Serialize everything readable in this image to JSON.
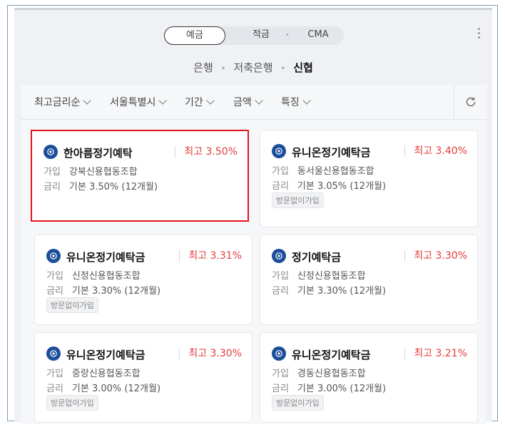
{
  "segments": {
    "items": [
      "예금",
      "적금",
      "CMA"
    ],
    "active": "예금"
  },
  "subtabs": {
    "items": [
      "은행",
      "저축은행",
      "신협"
    ],
    "active": "신협"
  },
  "filters": [
    "최고금리순",
    "서울특별시",
    "기간",
    "금액",
    "특징"
  ],
  "icons": {
    "refresh": "refresh-icon",
    "more": "more-vertical-icon",
    "bank_logo": "shinhyup-logo-icon",
    "chevron": "chevron-down-icon"
  },
  "colors": {
    "rate_red": "#e53b3b",
    "highlight_border": "#e3141d",
    "logo_blue": "#1c4e9a"
  },
  "labels": {
    "join": "가입",
    "rate": "금리"
  },
  "products": [
    {
      "name": "한아름정기예탁",
      "max_rate": "최고 3.50%",
      "join": "강북신용협동조합",
      "base": "기본 3.50% (12개월)",
      "badge": ""
    },
    {
      "name": "유니온정기예탁금",
      "max_rate": "최고 3.40%",
      "join": "동서울신용협동조합",
      "base": "기본 3.05% (12개월)",
      "badge": "방문없이가입"
    },
    {
      "name": "유니온정기예탁금",
      "max_rate": "최고 3.31%",
      "join": "신정신용협동조합",
      "base": "기본 3.30% (12개월)",
      "badge": "방문없이가입"
    },
    {
      "name": "정기예탁금",
      "max_rate": "최고 3.30%",
      "join": "신정신용협동조합",
      "base": "기본 3.30% (12개월)",
      "badge": ""
    },
    {
      "name": "유니온정기예탁금",
      "max_rate": "최고 3.30%",
      "join": "중랑신용협동조합",
      "base": "기본 3.00% (12개월)",
      "badge": "방문없이가입"
    },
    {
      "name": "유니온정기예탁금",
      "max_rate": "최고 3.21%",
      "join": "경동신용협동조합",
      "base": "기본 3.00% (12개월)",
      "badge": "방문없이가입"
    }
  ]
}
